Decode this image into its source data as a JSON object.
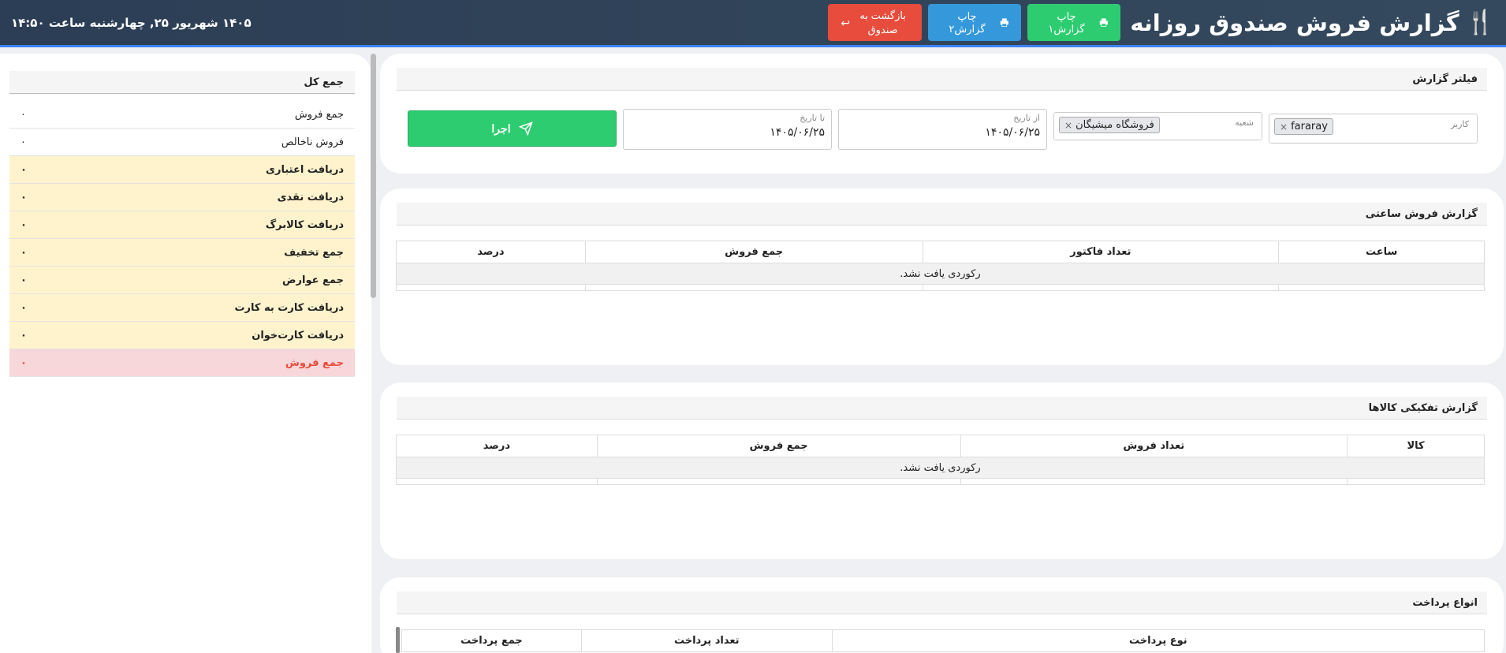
{
  "header": {
    "title": "گزارش فروش صندوق روزانه",
    "print1_label": "چاپ گزارش۱",
    "print2_label": "چاپ گزارش۲",
    "back_label": "بازگشت به صندوق",
    "datetime": "۱۴۰۵ شهریور ۲۵, چهارشنبه ساعت ۱۴:۵۰"
  },
  "filter": {
    "title": "فیلتر گزارش",
    "user_label": "کاربر",
    "user_value": "fararay",
    "branch_label": "شعبه",
    "branch_value": "فروشگاه میشیگان",
    "from_label": "از تاریخ",
    "from_value": "۱۴۰۵/۰۶/۲۵",
    "to_label": "تا تاریخ",
    "to_value": "۱۴۰۵/۰۶/۲۵",
    "run_label": "اجرا"
  },
  "hourly": {
    "title": "گزارش فروش ساعتی",
    "columns": [
      "ساعت",
      "تعداد فاکتور",
      "جمع فروش",
      "درصد"
    ],
    "empty": "رکوردی یافت نشد."
  },
  "items": {
    "title": "گزارش تفکیکی کالاها",
    "columns": [
      "کالا",
      "تعداد فروش",
      "جمع فروش",
      "درصد"
    ],
    "empty": "رکوردی یافت نشد."
  },
  "payments": {
    "title": "انواع پرداخت",
    "columns": [
      "نوع پرداخت",
      "تعداد پرداخت",
      "جمع پرداخت"
    ]
  },
  "summary": {
    "title": "جمع کل",
    "rows": [
      {
        "label": "جمع فروش",
        "value": "۰"
      },
      {
        "label": "فروش ناخالص",
        "value": "۰"
      },
      {
        "label": "دریافت اعتباری",
        "value": "۰"
      },
      {
        "label": "دریافت نقدی",
        "value": "۰"
      },
      {
        "label": "دریافت کالابرگ",
        "value": "۰"
      },
      {
        "label": "جمع تخفیف",
        "value": "۰"
      },
      {
        "label": "جمع عوارض",
        "value": "۰"
      },
      {
        "label": "دریافت کارت به کارت",
        "value": "۰"
      },
      {
        "label": "دریافت کارت‌خوان",
        "value": "۰"
      },
      {
        "label": "جمع فروش",
        "value": "۰"
      }
    ]
  }
}
